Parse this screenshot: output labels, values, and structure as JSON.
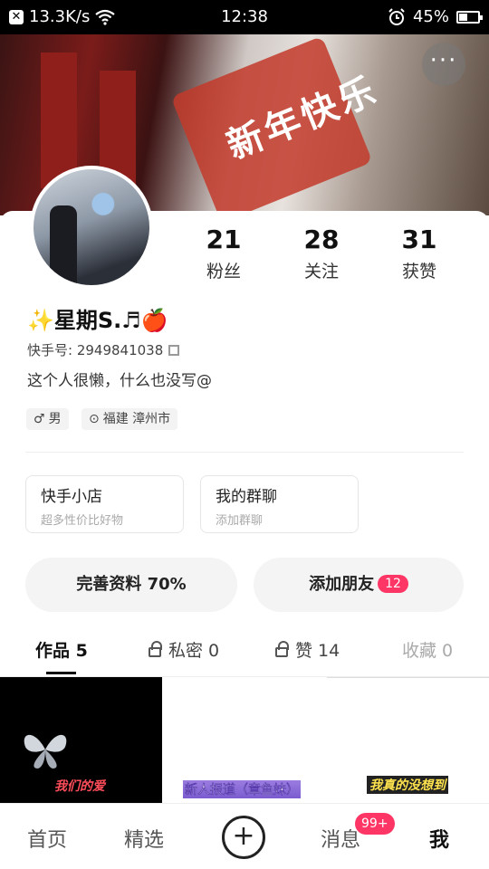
{
  "status_bar": {
    "speed": "13.3K/s",
    "time": "12:38",
    "battery": "45%",
    "battery_level": 0.45
  },
  "cover": {
    "text": "新年快乐",
    "more_label": "···"
  },
  "profile": {
    "nickname": "✨星期S.♬🍎",
    "uid": "快手号: 2949841038",
    "bio": "这个人很懒，什么也没写@",
    "tags": [
      {
        "icon": "♂",
        "label": "男"
      },
      {
        "icon": "⊙",
        "label": "福建 漳州市"
      }
    ]
  },
  "stats": [
    {
      "value": "21",
      "label": "粉丝"
    },
    {
      "value": "28",
      "label": "关注"
    },
    {
      "value": "31",
      "label": "获赞"
    }
  ],
  "cards": [
    {
      "title": "快手小店",
      "subtitle": "超多性价比好物"
    },
    {
      "title": "我的群聊",
      "subtitle": "添加群聊"
    }
  ],
  "actions": {
    "complete_profile": "完善资料 70%",
    "add_friends": "添加朋友",
    "add_friends_badge": "12"
  },
  "tabs": [
    {
      "label": "作品 5"
    },
    {
      "label": "私密 0"
    },
    {
      "label": "赞 14"
    },
    {
      "label": "收藏 0"
    }
  ],
  "thumbnails": [
    {
      "caption": "我们的爱"
    },
    {
      "caption": "新人报道（章鱼妹）"
    },
    {
      "caption": "我真的没想到"
    }
  ],
  "bottom_nav": {
    "home": "首页",
    "featured": "精选",
    "create": "+",
    "messages": "消息",
    "messages_badge": "99+",
    "me": "我"
  },
  "colors": {
    "accent": "#fe3666",
    "status_bar": "#000000"
  }
}
